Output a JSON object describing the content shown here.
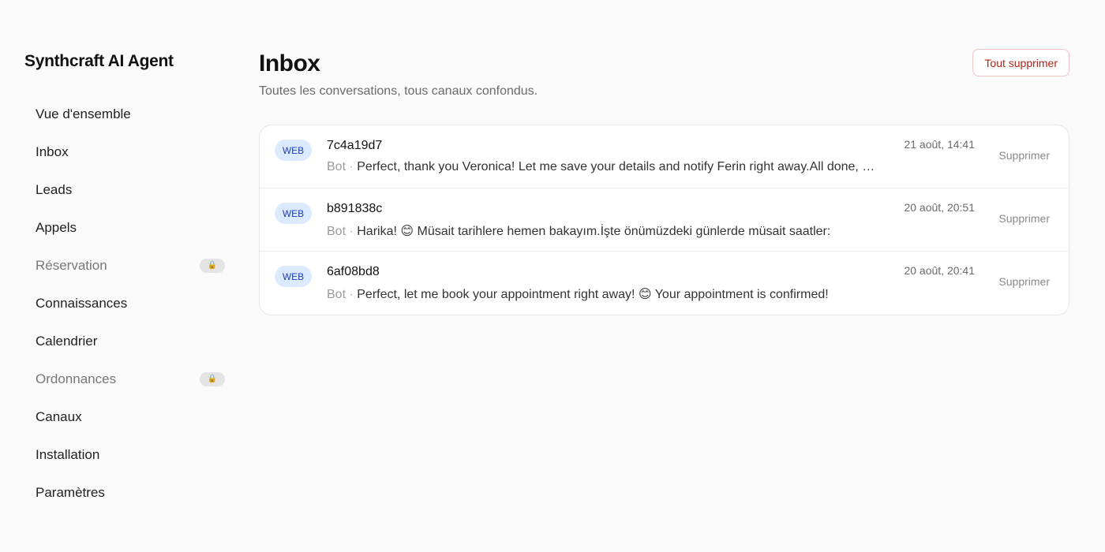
{
  "sidebar": {
    "brand": "Synthcraft AI Agent",
    "items": [
      {
        "label": "Vue d'ensemble",
        "locked": false
      },
      {
        "label": "Inbox",
        "locked": false
      },
      {
        "label": "Leads",
        "locked": false
      },
      {
        "label": "Appels",
        "locked": false
      },
      {
        "label": "Réservation",
        "locked": true,
        "badge": "🔒"
      },
      {
        "label": "Connaissances",
        "locked": false
      },
      {
        "label": "Calendrier",
        "locked": false
      },
      {
        "label": "Ordonnances",
        "locked": true,
        "badge": "🔒"
      },
      {
        "label": "Canaux",
        "locked": false
      },
      {
        "label": "Installation",
        "locked": false
      },
      {
        "label": "Paramètres",
        "locked": false
      }
    ]
  },
  "main": {
    "title": "Inbox",
    "subtitle": "Toutes les conversations, tous canaux confondus.",
    "delete_all_label": "Tout supprimer",
    "conversations": [
      {
        "channel": "WEB",
        "id": "7c4a19d7",
        "sender": "Bot",
        "separator": "·",
        "preview": "Perfect, thank you Veronica! Let me save your details and notify Ferin right away.All done, Veronica!",
        "date": "21 août, 14:41",
        "delete_label": "Supprimer"
      },
      {
        "channel": "WEB",
        "id": "b891838c",
        "sender": "Bot",
        "separator": "·",
        "preview": "Harika! 😊 Müsait tarihlere hemen bakayım.İşte önümüzdeki günlerde müsait saatler:",
        "date": "20 août, 20:51",
        "delete_label": "Supprimer"
      },
      {
        "channel": "WEB",
        "id": "6af08bd8",
        "sender": "Bot",
        "separator": "·",
        "preview": "Perfect, let me book your appointment right away! 😊 Your appointment is confirmed!",
        "date": "20 août, 20:41",
        "delete_label": "Supprimer"
      }
    ]
  },
  "colors": {
    "background": "#fafafa",
    "web_badge_bg": "#dbeafe",
    "web_badge_text": "#1e40af",
    "danger": "#b42318"
  }
}
